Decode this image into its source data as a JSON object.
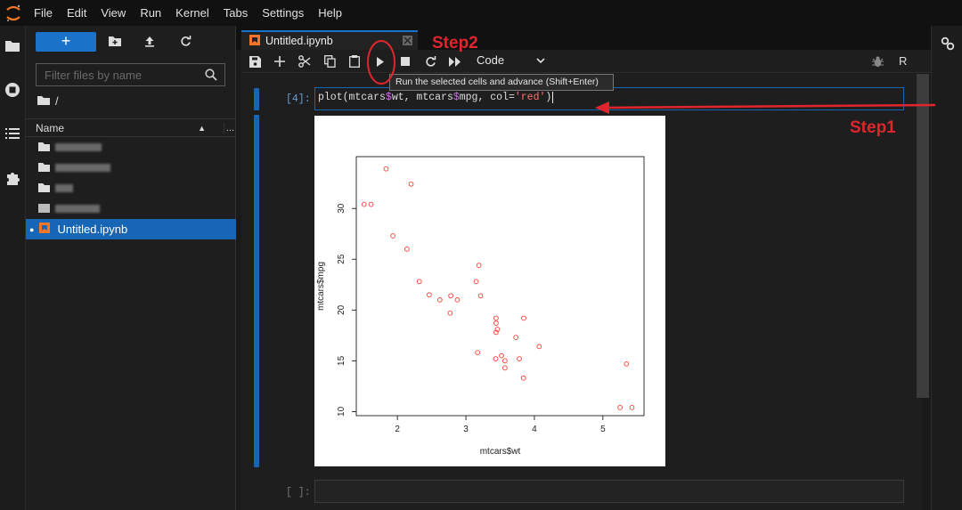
{
  "menubar": {
    "items": [
      "File",
      "Edit",
      "View",
      "Run",
      "Kernel",
      "Tabs",
      "Settings",
      "Help"
    ]
  },
  "filebrowser": {
    "new_label": "+",
    "filter_placeholder": "Filter files by name",
    "breadcrumb": "/",
    "column_name": "Name",
    "column_more": "...",
    "files": [
      {
        "name": "",
        "type": "folder",
        "blurred": true
      },
      {
        "name": "",
        "type": "folder",
        "blurred": true
      },
      {
        "name": "",
        "type": "folder",
        "blurred": true
      },
      {
        "name": "",
        "type": "file",
        "blurred": true
      },
      {
        "name": "Untitled.ipynb",
        "type": "notebook",
        "selected": true
      }
    ]
  },
  "tab": {
    "title": "Untitled.ipynb"
  },
  "toolbar": {
    "cell_type": "Code",
    "kernel": "R",
    "tooltip": "Run the selected cells and advance (Shift+Enter)"
  },
  "cells": [
    {
      "prompt": "[4]:",
      "code_parts": [
        "plot(mtcars",
        "$",
        "wt, mtcars",
        "$",
        "mpg, col=",
        "'red'",
        ")"
      ]
    },
    {
      "prompt": "[ ]:",
      "code": ""
    }
  ],
  "annotations": {
    "step1": "Step1",
    "step2": "Step2"
  },
  "colors": {
    "accent": "#1766b5",
    "annotation": "#e0262c",
    "point": "#ff3b30"
  },
  "chart_data": {
    "type": "scatter",
    "xlabel": "mtcars$wt",
    "ylabel": "mtcars$mpg",
    "x_ticks": [
      "2",
      "3",
      "4",
      "5"
    ],
    "y_ticks": [
      "10",
      "15",
      "20",
      "25",
      "30"
    ],
    "xlim": [
      1.4,
      5.6
    ],
    "ylim": [
      9.6,
      35.1
    ],
    "marker": "open-circle",
    "color": "red",
    "points": [
      [
        2.62,
        21.0
      ],
      [
        2.875,
        21.0
      ],
      [
        2.32,
        22.8
      ],
      [
        3.215,
        21.4
      ],
      [
        3.44,
        18.7
      ],
      [
        3.46,
        18.1
      ],
      [
        3.57,
        14.3
      ],
      [
        3.19,
        24.4
      ],
      [
        3.15,
        22.8
      ],
      [
        3.44,
        19.2
      ],
      [
        3.44,
        17.8
      ],
      [
        4.07,
        16.4
      ],
      [
        3.73,
        17.3
      ],
      [
        3.78,
        15.2
      ],
      [
        5.25,
        10.4
      ],
      [
        5.424,
        10.4
      ],
      [
        5.345,
        14.7
      ],
      [
        2.2,
        32.4
      ],
      [
        1.615,
        30.4
      ],
      [
        1.835,
        33.9
      ],
      [
        2.465,
        21.5
      ],
      [
        3.52,
        15.5
      ],
      [
        3.435,
        15.2
      ],
      [
        3.84,
        13.3
      ],
      [
        3.845,
        19.2
      ],
      [
        1.935,
        27.3
      ],
      [
        2.14,
        26.0
      ],
      [
        1.513,
        30.4
      ],
      [
        3.17,
        15.8
      ],
      [
        2.77,
        19.7
      ],
      [
        3.57,
        15.0
      ],
      [
        2.78,
        21.4
      ]
    ]
  }
}
